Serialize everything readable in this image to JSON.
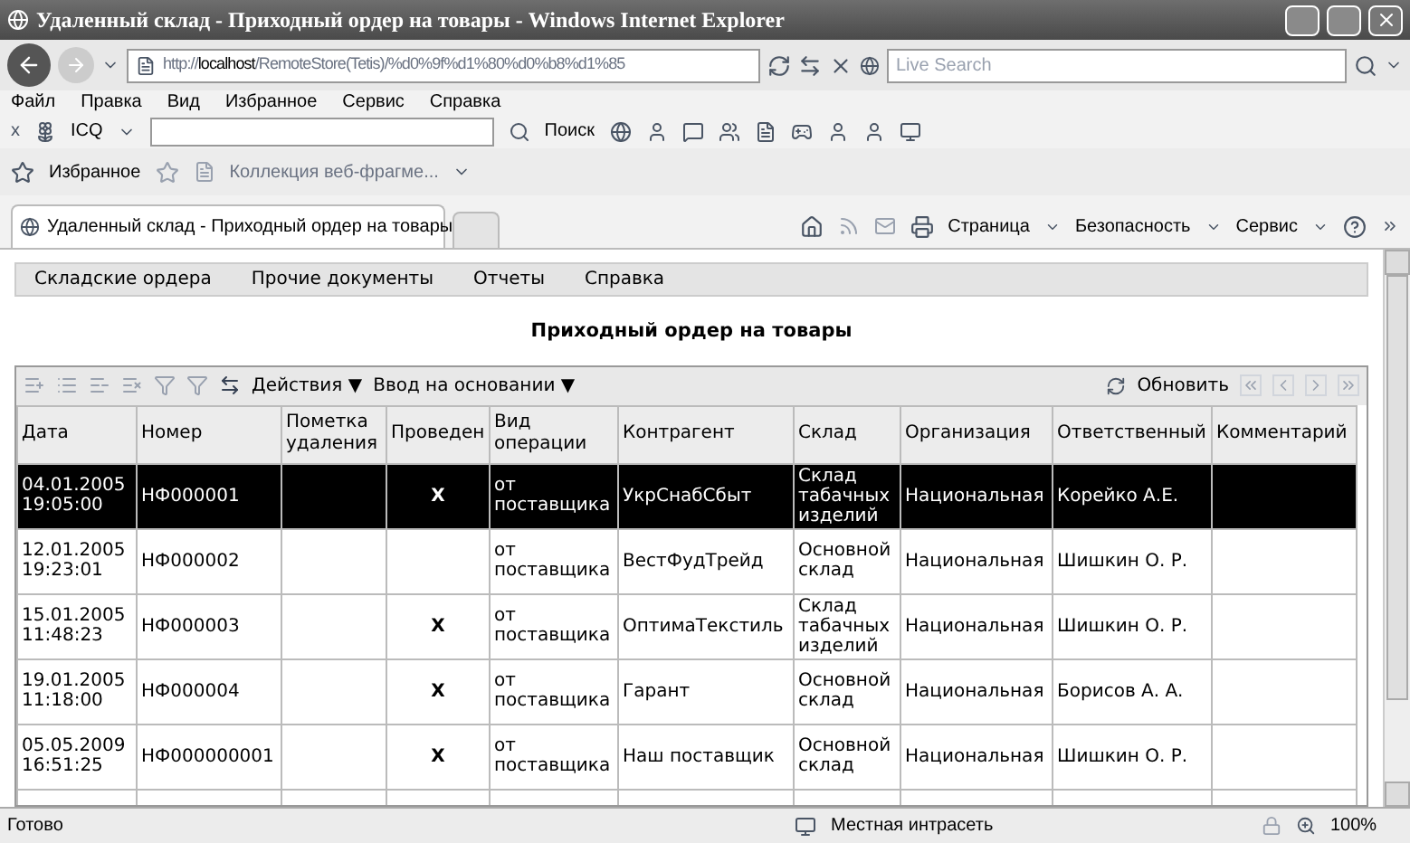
{
  "window": {
    "title": "Удаленный склад - Приходный ордер на товары - Windows Internet Explorer"
  },
  "address_bar": {
    "url_prefix": "http://",
    "url_host": "localhost",
    "url_rest": "/RemoteStore(Tetis)/%d0%9f%d1%80%d0%b8%d1%85",
    "search_placeholder": "Live Search"
  },
  "menu": [
    "Файл",
    "Правка",
    "Вид",
    "Избранное",
    "Сервис",
    "Справка"
  ],
  "toolbar": {
    "close": "x",
    "icq": "ICQ",
    "search": "Поиск"
  },
  "favorites_bar": {
    "favorites": "Избранное",
    "gallery": "Коллекция веб-фрагме..."
  },
  "tab": {
    "title": "Удаленный склад - Приходный ордер на товары"
  },
  "command_bar": [
    "Страница",
    "Безопасность",
    "Сервис"
  ],
  "page_menu": [
    "Складские ордера",
    "Прочие документы",
    "Отчеты",
    "Справка"
  ],
  "page_title": "Приходный ордер на товары",
  "grid_toolbar": {
    "actions": [
      "Действия ▼",
      "Ввод на основании ▼"
    ],
    "refresh": "Обновить"
  },
  "table": {
    "columns": [
      "Дата",
      "Номер",
      "Пометка удаления",
      "Проведен",
      "Вид операции",
      "Контрагент",
      "Склад",
      "Организация",
      "Ответственный",
      "Комментарий"
    ],
    "rows": [
      {
        "selected": true,
        "cells": [
          "04.01.2005 19:05:00",
          "НФ000001",
          "",
          "X",
          "от поставщика",
          "УкрСнабСбыт",
          "Склад табачных изделий",
          "Национальная",
          "Корейко А.Е.",
          ""
        ]
      },
      {
        "selected": false,
        "cells": [
          "12.01.2005 19:23:01",
          "НФ000002",
          "",
          "",
          "от поставщика",
          "ВестФудТрейд",
          "Основной склад",
          "Национальная",
          "Шишкин О. Р.",
          ""
        ]
      },
      {
        "selected": false,
        "cells": [
          "15.01.2005 11:48:23",
          "НФ000003",
          "",
          "X",
          "от поставщика",
          "ОптимаТекстиль",
          "Склад табачных изделий",
          "Национальная",
          "Шишкин О. Р.",
          ""
        ]
      },
      {
        "selected": false,
        "cells": [
          "19.01.2005 11:18:00",
          "НФ000004",
          "",
          "X",
          "от поставщика",
          "Гарант",
          "Основной склад",
          "Национальная",
          "Борисов А. А.",
          ""
        ]
      },
      {
        "selected": false,
        "cells": [
          "05.05.2009 16:51:25",
          "НФ000000001",
          "",
          "X",
          "от поставщика",
          "Наш поставщик",
          "Основной склад",
          "Национальная",
          "Шишкин О. Р.",
          ""
        ]
      }
    ]
  },
  "status_bar": {
    "text": "Готово",
    "zone": "Местная интрасеть",
    "zoom": "100%"
  }
}
